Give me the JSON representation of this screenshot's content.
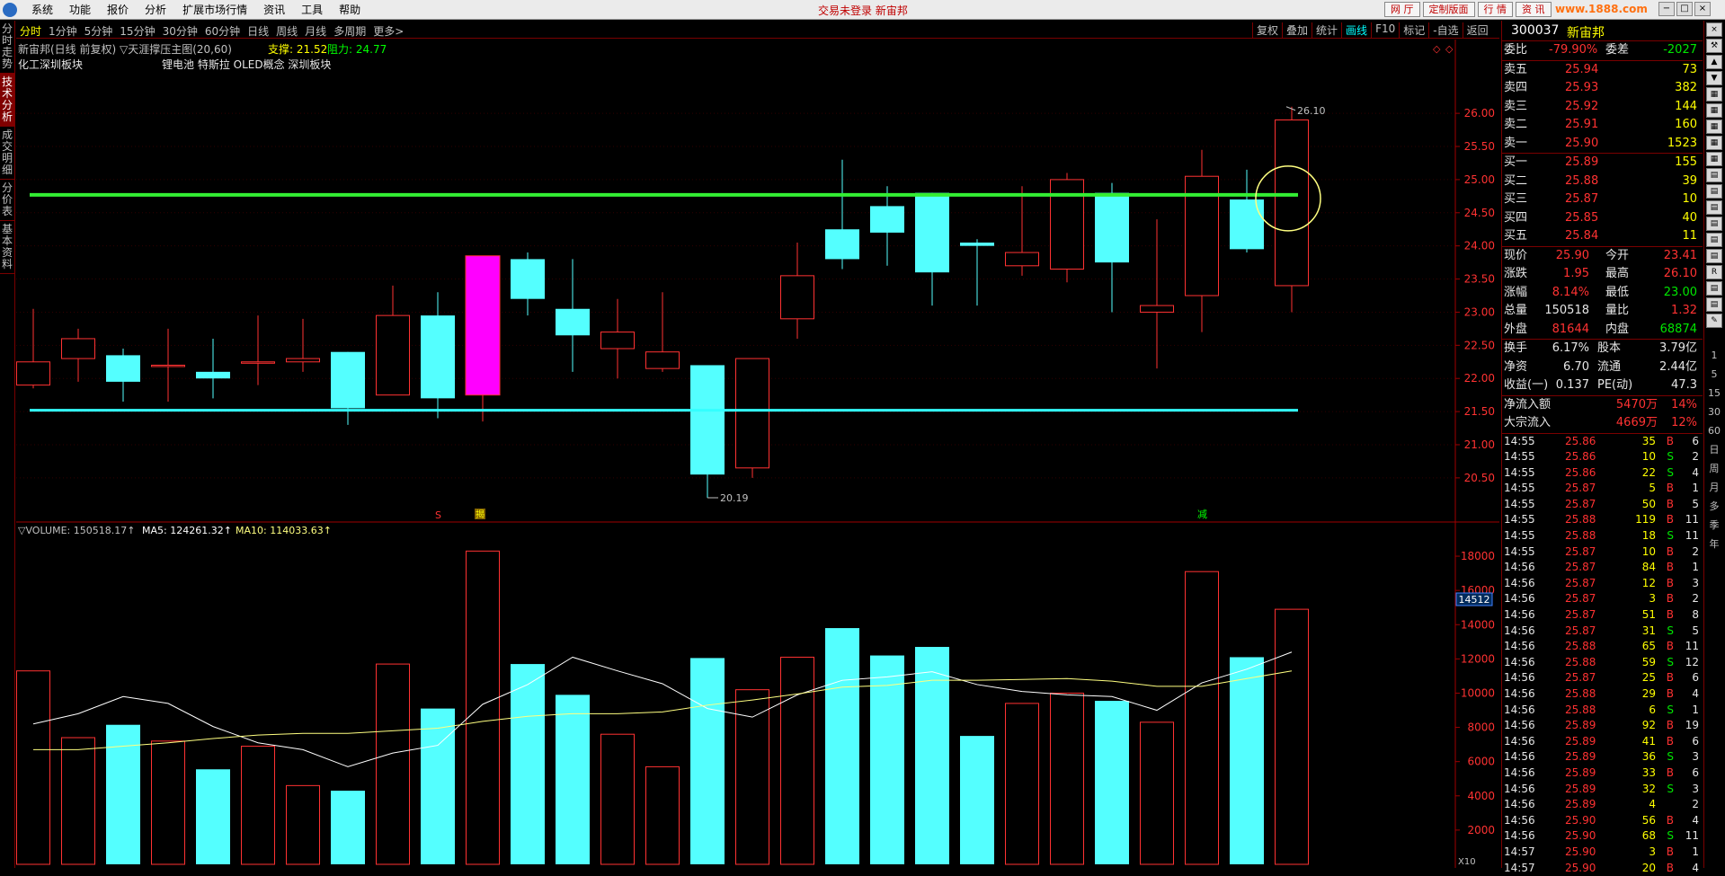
{
  "menubar": {
    "items": [
      "系统",
      "功能",
      "报价",
      "分析",
      "扩展市场行情",
      "资讯",
      "工具",
      "帮助"
    ],
    "title": "交易未登录  新宙邦",
    "right_buttons": [
      "网 厅",
      "定制版面",
      "行 情",
      "资 讯"
    ],
    "window_controls": [
      "−",
      "□",
      "×"
    ],
    "watermark": "www.1888.com"
  },
  "left_tabs": [
    {
      "label": "分时走势",
      "active": false
    },
    {
      "label": "技术分析",
      "active": true
    },
    {
      "label": "成交明细",
      "active": false
    },
    {
      "label": "分价表",
      "active": false
    },
    {
      "label": "基本资料",
      "active": false
    }
  ],
  "periods": [
    "分时",
    "1分钟",
    "5分钟",
    "15分钟",
    "30分钟",
    "60分钟",
    "日线",
    "周线",
    "月线",
    "多周期",
    "更多>"
  ],
  "selected_period": "分时",
  "tool_buttons": [
    "复权",
    "叠加",
    "统计",
    "画线",
    "F10",
    "标记",
    "-自选",
    "返回"
  ],
  "selected_tool": "画线",
  "chart_info": {
    "title": "新宙邦(日线 前复权) ▽天涯撑压主图(20,60)",
    "support_label": "支撑: 21.52",
    "resist_label": "阻力: 24.77",
    "concept_left": "化工深圳板块",
    "concept_right": "锂电池 特斯拉 OLED概念 深圳板块",
    "marker_s": "S",
    "marker_top": "揭",
    "marker_jian": "减",
    "volume_label": "▽VOLUME: 150518.17↑",
    "ma5_label": "MA5: 124261.32↑",
    "ma10_label": "MA10: 114033.63↑",
    "vol_current_tag": "14512",
    "x10": "X10"
  },
  "chart_data": {
    "type": "candlestick",
    "price_ticks": [
      20.5,
      21.0,
      21.5,
      22.0,
      22.5,
      23.0,
      23.5,
      24.0,
      24.5,
      25.0,
      25.5,
      26.0
    ],
    "price_range": [
      20.2,
      26.3
    ],
    "volume_ticks": [
      2000,
      4000,
      6000,
      8000,
      10000,
      12000,
      14000,
      16000,
      18000
    ],
    "volume_range": [
      0,
      19000
    ],
    "support": 21.52,
    "resistance": 24.77,
    "high_label": "26.10",
    "low_label": "20.19",
    "candles": [
      {
        "o": 21.9,
        "c": 22.25,
        "h": 23.05,
        "l": 21.85,
        "v": 11300
      },
      {
        "o": 22.3,
        "c": 22.6,
        "h": 22.75,
        "l": 21.95,
        "v": 7400
      },
      {
        "o": 22.35,
        "c": 21.95,
        "h": 22.45,
        "l": 21.65,
        "v": 8150
      },
      {
        "o": 22.2,
        "c": 22.2,
        "h": 22.75,
        "l": 21.65,
        "v": 7200
      },
      {
        "o": 22.1,
        "c": 22.0,
        "h": 22.6,
        "l": 21.7,
        "v": 5550
      },
      {
        "o": 22.25,
        "c": 22.25,
        "h": 22.95,
        "l": 21.9,
        "v": 6900
      },
      {
        "o": 22.25,
        "c": 22.3,
        "h": 22.9,
        "l": 22.1,
        "v": 4600
      },
      {
        "o": 22.4,
        "c": 21.55,
        "h": 22.4,
        "l": 21.3,
        "v": 4300
      },
      {
        "o": 21.75,
        "c": 22.95,
        "h": 23.4,
        "l": 21.75,
        "v": 11700
      },
      {
        "o": 22.95,
        "c": 21.7,
        "h": 23.3,
        "l": 21.4,
        "v": 9100
      },
      {
        "o": 21.75,
        "c": 23.85,
        "h": 23.85,
        "l": 21.35,
        "v": 18300
      },
      {
        "o": 23.8,
        "c": 23.2,
        "h": 23.9,
        "l": 22.95,
        "v": 11700
      },
      {
        "o": 23.05,
        "c": 22.65,
        "h": 23.8,
        "l": 22.1,
        "v": 9900
      },
      {
        "o": 22.45,
        "c": 22.7,
        "h": 23.2,
        "l": 22.0,
        "v": 7600
      },
      {
        "o": 22.15,
        "c": 22.4,
        "h": 23.3,
        "l": 22.1,
        "v": 5700
      },
      {
        "o": 22.2,
        "c": 20.55,
        "h": 22.2,
        "l": 20.2,
        "v": 12050
      },
      {
        "o": 20.65,
        "c": 22.3,
        "h": 22.3,
        "l": 20.5,
        "v": 10200
      },
      {
        "o": 22.9,
        "c": 23.55,
        "h": 24.05,
        "l": 22.6,
        "v": 12100
      },
      {
        "o": 24.25,
        "c": 23.8,
        "h": 25.3,
        "l": 23.65,
        "v": 13800
      },
      {
        "o": 24.6,
        "c": 24.2,
        "h": 24.9,
        "l": 23.7,
        "v": 12200
      },
      {
        "o": 24.8,
        "c": 23.6,
        "h": 24.8,
        "l": 23.1,
        "v": 12700
      },
      {
        "o": 24.05,
        "c": 24.0,
        "h": 24.1,
        "l": 23.1,
        "v": 7500
      },
      {
        "o": 23.7,
        "c": 23.9,
        "h": 24.9,
        "l": 23.55,
        "v": 9400
      },
      {
        "o": 23.65,
        "c": 25.0,
        "h": 25.1,
        "l": 23.45,
        "v": 10000
      },
      {
        "o": 24.8,
        "c": 23.75,
        "h": 24.95,
        "l": 23.0,
        "v": 9550
      },
      {
        "o": 23.0,
        "c": 23.1,
        "h": 24.4,
        "l": 22.15,
        "v": 8300
      },
      {
        "o": 23.25,
        "c": 25.05,
        "h": 25.45,
        "l": 22.7,
        "v": 17100
      },
      {
        "o": 24.7,
        "c": 23.95,
        "h": 25.15,
        "l": 23.9,
        "v": 12100
      },
      {
        "o": 23.4,
        "c": 25.9,
        "h": 26.1,
        "l": 23.0,
        "v": 14900
      }
    ],
    "ma5": [
      8200,
      8800,
      9800,
      9400,
      8050,
      7100,
      6700,
      5700,
      6500,
      6950,
      9350,
      10500,
      12100,
      11300,
      10550,
      9100,
      8600,
      9900,
      10750,
      10950,
      11250,
      10500,
      10100,
      9900,
      9800,
      9000,
      10600,
      11400,
      12400
    ],
    "ma10": [
      6700,
      6700,
      6900,
      7100,
      7350,
      7550,
      7650,
      7650,
      7800,
      7950,
      8350,
      8650,
      8800,
      8800,
      8900,
      9300,
      9600,
      9950,
      10350,
      10450,
      10750,
      10750,
      10800,
      10850,
      10700,
      10400,
      10400,
      10850,
      11300
    ]
  },
  "quote": {
    "code": "300037",
    "name": "新宙邦",
    "weibi_label": "委比",
    "weibi": "-79.90%",
    "weicha_label": "委差",
    "weicha": "-2027",
    "asks": [
      {
        "label": "卖五",
        "price": "25.94",
        "vol": "73"
      },
      {
        "label": "卖四",
        "price": "25.93",
        "vol": "382"
      },
      {
        "label": "卖三",
        "price": "25.92",
        "vol": "144"
      },
      {
        "label": "卖二",
        "price": "25.91",
        "vol": "160"
      },
      {
        "label": "卖一",
        "price": "25.90",
        "vol": "1523"
      }
    ],
    "bids": [
      {
        "label": "买一",
        "price": "25.89",
        "vol": "155"
      },
      {
        "label": "买二",
        "price": "25.88",
        "vol": "39"
      },
      {
        "label": "买三",
        "price": "25.87",
        "vol": "10"
      },
      {
        "label": "买四",
        "price": "25.85",
        "vol": "40"
      },
      {
        "label": "买五",
        "price": "25.84",
        "vol": "11"
      }
    ],
    "stats": [
      {
        "l1": "现价",
        "v1": "25.90",
        "c1": "r",
        "l2": "今开",
        "v2": "23.41",
        "c2": "r"
      },
      {
        "l1": "涨跌",
        "v1": "1.95",
        "c1": "r",
        "l2": "最高",
        "v2": "26.10",
        "c2": "r"
      },
      {
        "l1": "涨幅",
        "v1": "8.14%",
        "c1": "r",
        "l2": "最低",
        "v2": "23.00",
        "c2": "g"
      },
      {
        "l1": "总量",
        "v1": "150518",
        "c1": "w",
        "l2": "量比",
        "v2": "1.32",
        "c2": "r"
      },
      {
        "l1": "外盘",
        "v1": "81644",
        "c1": "r",
        "l2": "内盘",
        "v2": "68874",
        "c2": "g"
      }
    ],
    "stats2": [
      {
        "l1": "换手",
        "v1": "6.17%",
        "l2": "股本",
        "v2": "3.79亿"
      },
      {
        "l1": "净资",
        "v1": "6.70",
        "l2": "流通",
        "v2": "2.44亿"
      },
      {
        "l1": "收益(一)",
        "v1": "0.137",
        "l2": "PE(动)",
        "v2": "47.3"
      }
    ],
    "flows": [
      {
        "label": "净流入额",
        "value": "5470万",
        "pct": "14%"
      },
      {
        "label": "大宗流入",
        "value": "4669万",
        "pct": "12%"
      }
    ],
    "ticks": [
      {
        "t": "14:55",
        "p": "25.86",
        "v": "35",
        "s": "B",
        "n": "6"
      },
      {
        "t": "14:55",
        "p": "25.86",
        "v": "10",
        "s": "S",
        "n": "2"
      },
      {
        "t": "14:55",
        "p": "25.86",
        "v": "22",
        "s": "S",
        "n": "4"
      },
      {
        "t": "14:55",
        "p": "25.87",
        "v": "5",
        "s": "B",
        "n": "1"
      },
      {
        "t": "14:55",
        "p": "25.87",
        "v": "50",
        "s": "B",
        "n": "5"
      },
      {
        "t": "14:55",
        "p": "25.88",
        "v": "119",
        "s": "B",
        "n": "11"
      },
      {
        "t": "14:55",
        "p": "25.88",
        "v": "18",
        "s": "S",
        "n": "11"
      },
      {
        "t": "14:55",
        "p": "25.87",
        "v": "10",
        "s": "B",
        "n": "2"
      },
      {
        "t": "14:56",
        "p": "25.87",
        "v": "84",
        "s": "B",
        "n": "1"
      },
      {
        "t": "14:56",
        "p": "25.87",
        "v": "12",
        "s": "B",
        "n": "3"
      },
      {
        "t": "14:56",
        "p": "25.87",
        "v": "3",
        "s": "B",
        "n": "2"
      },
      {
        "t": "14:56",
        "p": "25.87",
        "v": "51",
        "s": "B",
        "n": "8"
      },
      {
        "t": "14:56",
        "p": "25.87",
        "v": "31",
        "s": "S",
        "n": "5"
      },
      {
        "t": "14:56",
        "p": "25.88",
        "v": "65",
        "s": "B",
        "n": "11"
      },
      {
        "t": "14:56",
        "p": "25.88",
        "v": "59",
        "s": "S",
        "n": "12"
      },
      {
        "t": "14:56",
        "p": "25.87",
        "v": "25",
        "s": "B",
        "n": "6"
      },
      {
        "t": "14:56",
        "p": "25.88",
        "v": "29",
        "s": "B",
        "n": "4"
      },
      {
        "t": "14:56",
        "p": "25.88",
        "v": "6",
        "s": "S",
        "n": "1"
      },
      {
        "t": "14:56",
        "p": "25.89",
        "v": "92",
        "s": "B",
        "n": "19"
      },
      {
        "t": "14:56",
        "p": "25.89",
        "v": "41",
        "s": "B",
        "n": "6"
      },
      {
        "t": "14:56",
        "p": "25.89",
        "v": "36",
        "s": "S",
        "n": "3"
      },
      {
        "t": "14:56",
        "p": "25.89",
        "v": "33",
        "s": "B",
        "n": "6"
      },
      {
        "t": "14:56",
        "p": "25.89",
        "v": "32",
        "s": "S",
        "n": "3"
      },
      {
        "t": "14:56",
        "p": "25.89",
        "v": "4",
        "s": "",
        "n": "2"
      },
      {
        "t": "14:56",
        "p": "25.90",
        "v": "56",
        "s": "B",
        "n": "4"
      },
      {
        "t": "14:56",
        "p": "25.90",
        "v": "68",
        "s": "S",
        "n": "11"
      },
      {
        "t": "14:57",
        "p": "25.90",
        "v": "3",
        "s": "B",
        "n": "1"
      },
      {
        "t": "14:57",
        "p": "25.90",
        "v": "20",
        "s": "B",
        "n": "4"
      }
    ]
  },
  "right_icons": [
    "1",
    "5",
    "15",
    "30",
    "60",
    "日",
    "周",
    "月",
    "多",
    "季",
    "年"
  ],
  "colors": {
    "up": "#ff3232",
    "down_fill": "#54ffff",
    "support": "#33ffff",
    "resistance": "#33ee33",
    "highlight": "#ff00ff"
  }
}
